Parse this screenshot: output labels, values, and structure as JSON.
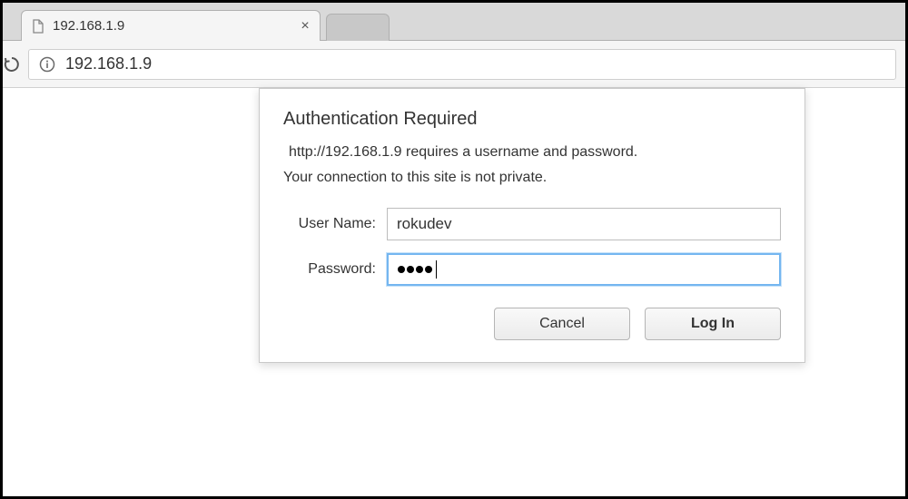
{
  "tab": {
    "title": "192.168.1.9"
  },
  "addressBar": {
    "url": "192.168.1.9"
  },
  "dialog": {
    "title": "Authentication Required",
    "message1": "http://192.168.1.9 requires a username and password.",
    "message2": "Your connection to this site is not private.",
    "usernameLabel": "User Name:",
    "passwordLabel": "Password:",
    "usernameValue": "rokudev",
    "passwordMaskedLength": 4,
    "cancelLabel": "Cancel",
    "loginLabel": "Log In"
  }
}
